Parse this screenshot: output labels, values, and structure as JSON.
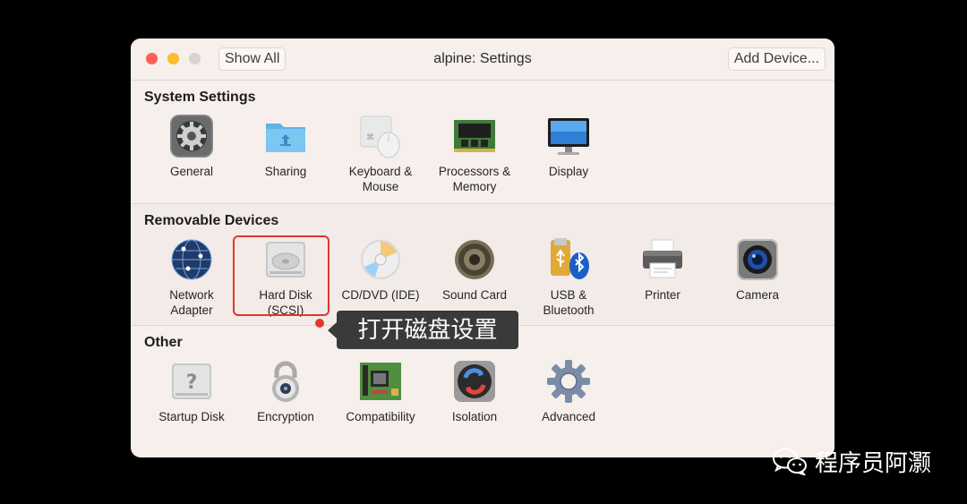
{
  "window": {
    "title": "alpine: Settings",
    "show_all_label": "Show All",
    "add_device_label": "Add Device..."
  },
  "sections": [
    {
      "title": "System Settings",
      "items": [
        {
          "label": "General",
          "icon": "gear-icon"
        },
        {
          "label": "Sharing",
          "icon": "shared-folder-icon"
        },
        {
          "label": "Keyboard &\nMouse",
          "icon": "keyboard-mouse-icon"
        },
        {
          "label": "Processors &\nMemory",
          "icon": "memory-chip-icon"
        },
        {
          "label": "Display",
          "icon": "display-icon"
        }
      ]
    },
    {
      "title": "Removable Devices",
      "items": [
        {
          "label": "Network\nAdapter",
          "icon": "globe-network-icon"
        },
        {
          "label": "Hard Disk\n(SCSI)",
          "icon": "hard-disk-icon"
        },
        {
          "label": "CD/DVD (IDE)",
          "icon": "cd-dvd-icon"
        },
        {
          "label": "Sound Card",
          "icon": "speaker-icon"
        },
        {
          "label": "USB &\nBluetooth",
          "icon": "usb-bluetooth-icon"
        },
        {
          "label": "Printer",
          "icon": "printer-icon"
        },
        {
          "label": "Camera",
          "icon": "camera-icon"
        }
      ]
    },
    {
      "title": "Other",
      "items": [
        {
          "label": "Startup Disk",
          "icon": "startup-disk-icon"
        },
        {
          "label": "Encryption",
          "icon": "padlock-icon"
        },
        {
          "label": "Compatibility",
          "icon": "motherboard-icon"
        },
        {
          "label": "Isolation",
          "icon": "isolation-icon"
        },
        {
          "label": "Advanced",
          "icon": "advanced-gear-icon"
        }
      ]
    }
  ],
  "annotation": {
    "tooltip": "打开磁盘设置",
    "highlight_color": "#e0362f"
  },
  "watermark": {
    "text": "程序员阿灏",
    "icon": "wechat-icon"
  }
}
